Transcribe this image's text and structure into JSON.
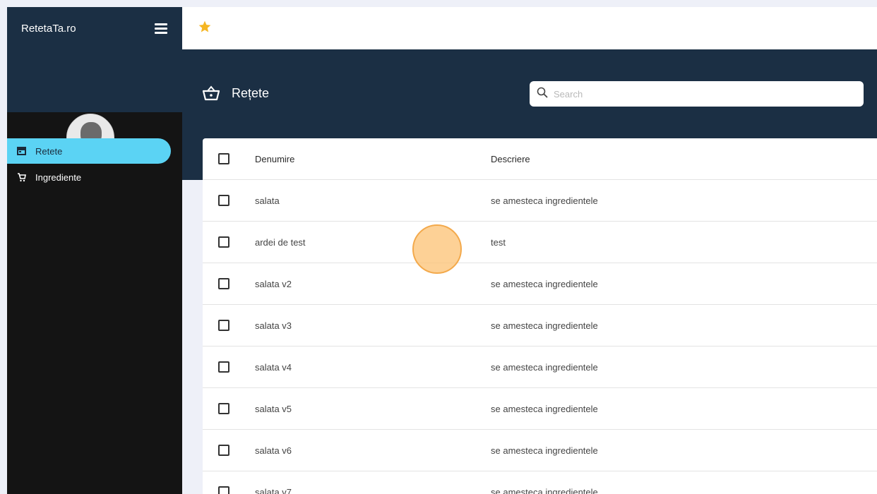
{
  "sidebar": {
    "brand": "RetetaTa.ro",
    "items": [
      {
        "label": "Retete",
        "icon": "store-icon",
        "active": true
      },
      {
        "label": "Ingrediente",
        "icon": "cart-icon",
        "active": false
      }
    ]
  },
  "topbar": {
    "favorite_icon": "star-icon"
  },
  "page": {
    "title": "Rețete",
    "icon": "basket-icon",
    "search_placeholder": "Search"
  },
  "table": {
    "headers": {
      "name": "Denumire",
      "description": "Descriere"
    },
    "rows": [
      {
        "name": "salata",
        "description": "se amesteca ingredientele"
      },
      {
        "name": "ardei de test",
        "description": "test"
      },
      {
        "name": "salata v2",
        "description": "se amesteca ingredientele"
      },
      {
        "name": "salata v3",
        "description": "se amesteca ingredientele"
      },
      {
        "name": "salata v4",
        "description": "se amesteca ingredientele"
      },
      {
        "name": "salata v5",
        "description": "se amesteca ingredientele"
      },
      {
        "name": "salata v6",
        "description": "se amesteca ingredientele"
      },
      {
        "name": "salata v7",
        "description": "se amesteca ingredientele"
      }
    ]
  },
  "colors": {
    "sidebar_header": "#1b2f44",
    "sidebar_bg": "#141414",
    "active_item": "#5bd3f4",
    "star": "#f5b623",
    "click_indicator": "#fdc478"
  }
}
